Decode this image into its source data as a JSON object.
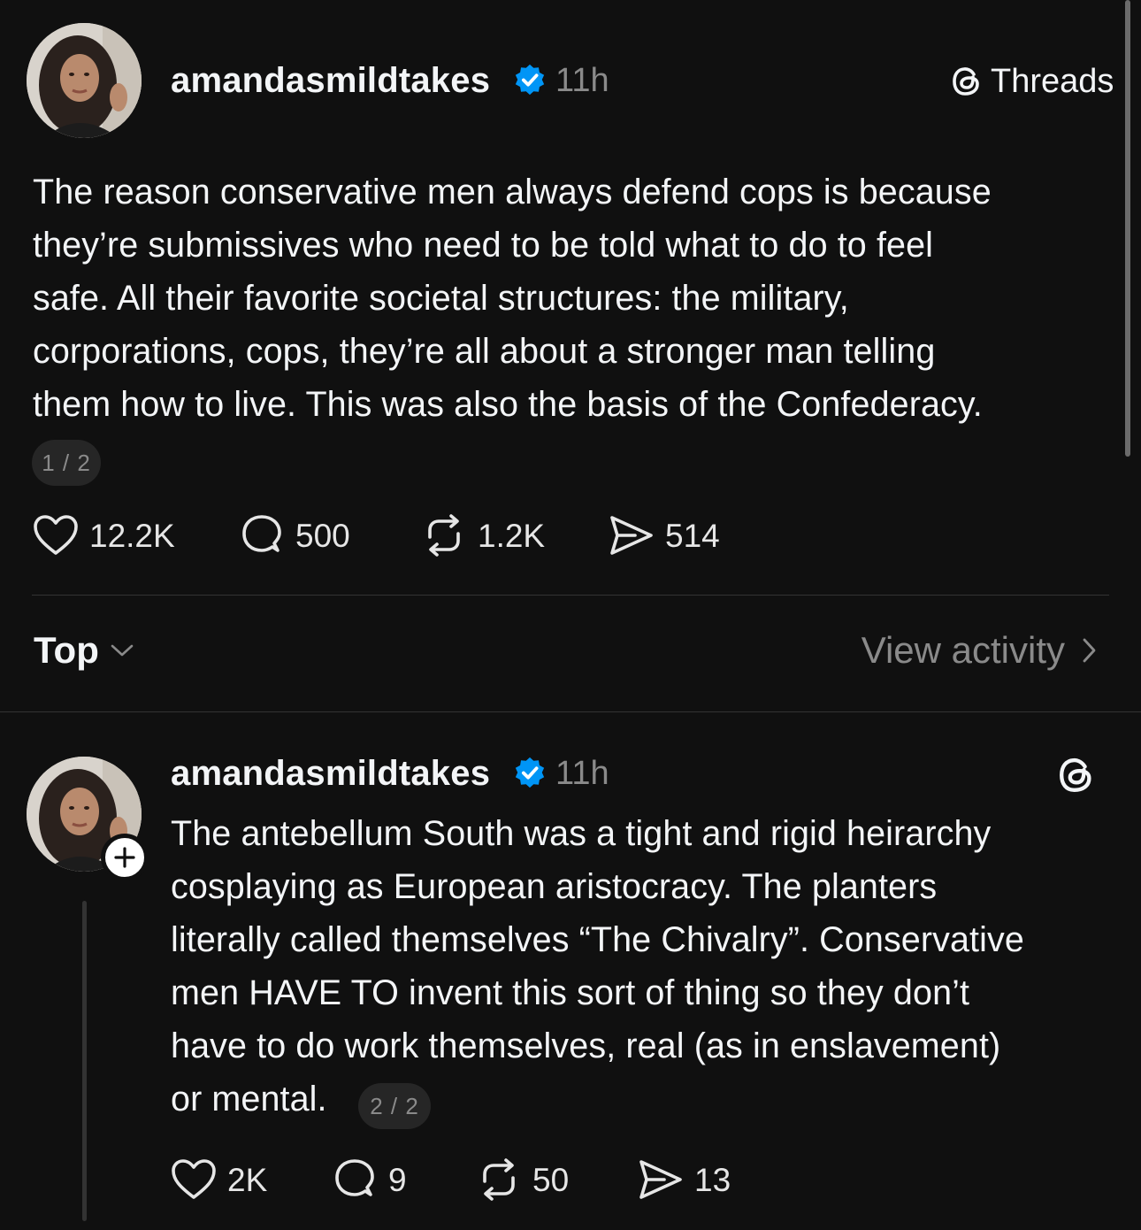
{
  "brand": {
    "name": "Threads",
    "icon": "threads-logo-icon"
  },
  "post1": {
    "username": "amandasmildtakes",
    "verified": true,
    "time": "11h",
    "text": "The reason conservative men always defend cops is because\nthey’re submissives who need to be told what to do to feel\nsafe. All their favorite societal structures: the military,\ncorporations, cops, they’re all about a stronger man telling\nthem how to live. This was also the basis of the Confederacy.",
    "counter": "1 / 2",
    "likes": "12.2K",
    "replies": "500",
    "reposts": "1.2K",
    "shares": "514"
  },
  "sort": {
    "label": "Top",
    "icon": "chevron-down-icon"
  },
  "view_activity": {
    "label": "View activity",
    "icon": "chevron-right-icon"
  },
  "post2": {
    "username": "amandasmildtakes",
    "verified": true,
    "time": "11h",
    "text": "The antebellum South was a tight and rigid heirarchy\ncosplaying as European aristocracy. The planters\nliterally called themselves “The Chivalry”. Conservative\nmen HAVE TO invent this sort of thing so they don’t\nhave to do work themselves, real (as in enslavement)\nor mental.",
    "counter": "2 / 2",
    "likes": "2K",
    "replies": "9",
    "reposts": "50",
    "shares": "13"
  },
  "colors": {
    "background": "#101010",
    "text": "#f3f5f7",
    "muted": "#8a8a8a",
    "verified": "#0095f6",
    "divider": "#333333"
  }
}
